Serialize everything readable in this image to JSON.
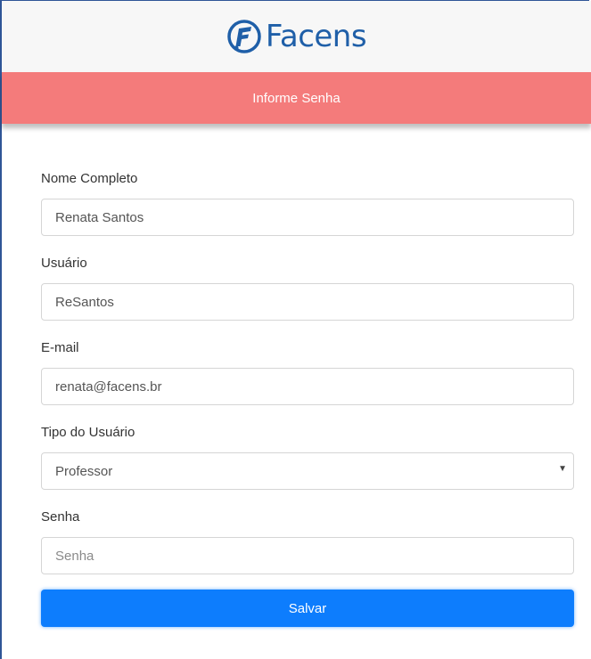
{
  "brand": {
    "logo_text": "Facens",
    "logo_color": "#1f5fa8"
  },
  "header": {
    "title": "Informe Senha",
    "color": "#f47b7b"
  },
  "form": {
    "full_name": {
      "label": "Nome Completo",
      "value": "Renata Santos"
    },
    "username": {
      "label": "Usuário",
      "value": "ReSantos"
    },
    "email": {
      "label": "E-mail",
      "value": "renata@facens.br"
    },
    "user_type": {
      "label": "Tipo do Usuário",
      "selected": "Professor"
    },
    "password": {
      "label": "Senha",
      "placeholder": "Senha"
    },
    "submit_label": "Salvar",
    "submit_color": "#0d7dfd"
  },
  "icons": {
    "logo": "facens-logo-icon",
    "select_arrow": "caret-down-icon"
  }
}
